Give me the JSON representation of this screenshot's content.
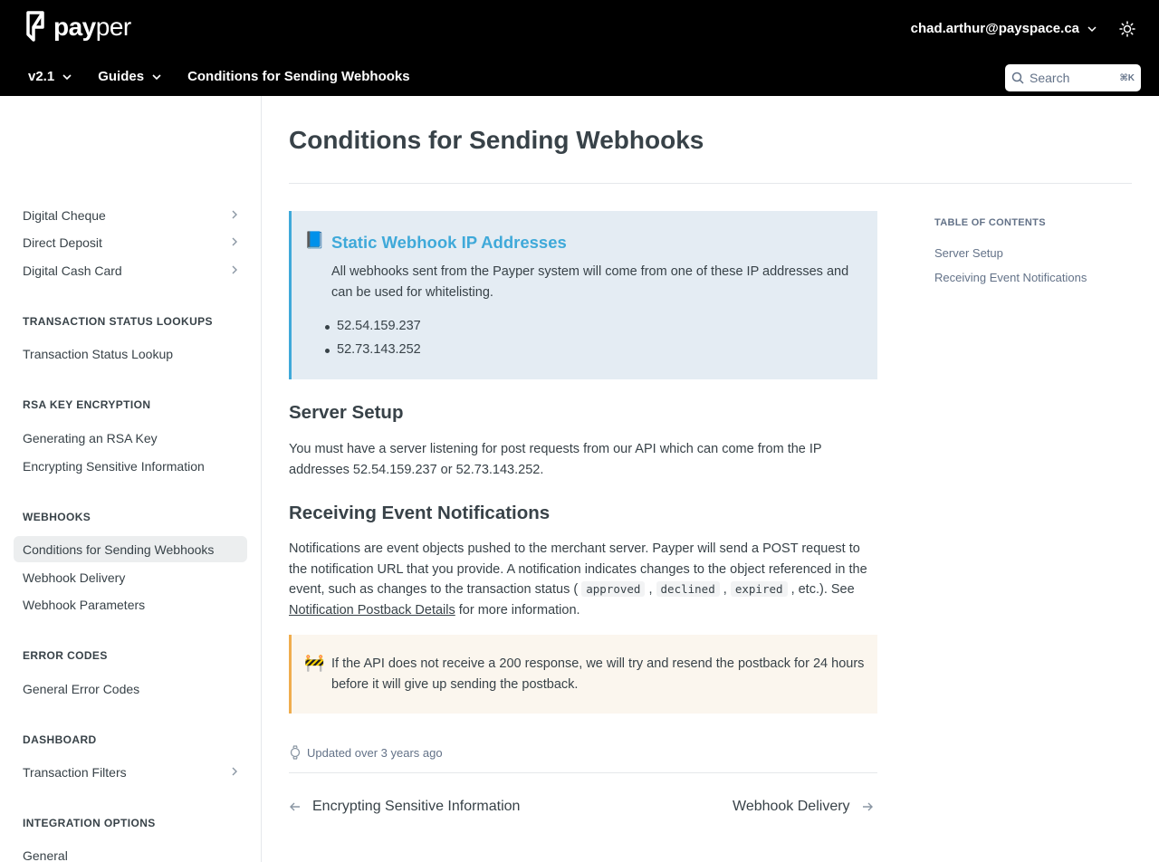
{
  "header": {
    "logo": {
      "bold": "pay",
      "light": "per"
    },
    "user_email": "chad.arthur@payspace.ca",
    "nav": [
      {
        "label": "v2.1"
      },
      {
        "label": "Guides"
      },
      {
        "label": "Conditions for Sending Webhooks"
      }
    ],
    "search": {
      "placeholder": "Search",
      "shortcut": "⌘K"
    }
  },
  "sidebar": {
    "items_top": [
      "Digital Cheque",
      "Direct Deposit",
      "Digital Cash Card"
    ],
    "sections": [
      {
        "heading": "TRANSACTION STATUS LOOKUPS",
        "items": [
          "Transaction Status Lookup"
        ]
      },
      {
        "heading": "RSA KEY ENCRYPTION",
        "items": [
          "Generating an RSA Key",
          "Encrypting Sensitive Information"
        ]
      },
      {
        "heading": "WEBHOOKS",
        "items": [
          "Conditions for Sending Webhooks",
          "Webhook Delivery",
          "Webhook Parameters"
        ]
      },
      {
        "heading": "ERROR CODES",
        "items": [
          "General Error Codes"
        ]
      },
      {
        "heading": "DASHBOARD",
        "items": [
          "Transaction Filters"
        ]
      },
      {
        "heading": "INTEGRATION OPTIONS",
        "items": [
          "General"
        ]
      }
    ]
  },
  "page": {
    "title": "Conditions for Sending Webhooks",
    "info_callout": {
      "emoji": "📘",
      "title": "Static Webhook IP Addresses",
      "text": "All webhooks sent from the Payper system will come from one of these IP addresses and can be used for whitelisting.",
      "ips": [
        "52.54.159.237",
        "52.73.143.252"
      ]
    },
    "server_setup": {
      "heading": "Server Setup",
      "text": "You must have a server listening for post requests from our API which can come from the IP addresses 52.54.159.237 or 52.73.143.252."
    },
    "receiving": {
      "heading": "Receiving Event Notifications",
      "text_before": "Notifications are event objects pushed to the merchant server. Payper will send a POST request to the notification URL that you provide. A notification indicates changes to the object referenced in the event, such as changes to the transaction status (",
      "code1": "approved",
      "code2": "declined",
      "code3": "expired",
      "text_mid": ", etc.). See ",
      "link": "Notification Postback Details",
      "text_after": " for more information."
    },
    "warn_callout": {
      "emoji": "🚧",
      "text": "If the API does not receive a 200 response, we will try and resend the postback for 24 hours before it will give up sending the postback."
    },
    "updated": "Updated over 3 years ago",
    "prev": "Encrypting Sensitive Information",
    "next": "Webhook Delivery"
  },
  "toc": {
    "heading": "TABLE OF CONTENTS",
    "items": [
      "Server Setup",
      "Receiving Event Notifications"
    ]
  }
}
